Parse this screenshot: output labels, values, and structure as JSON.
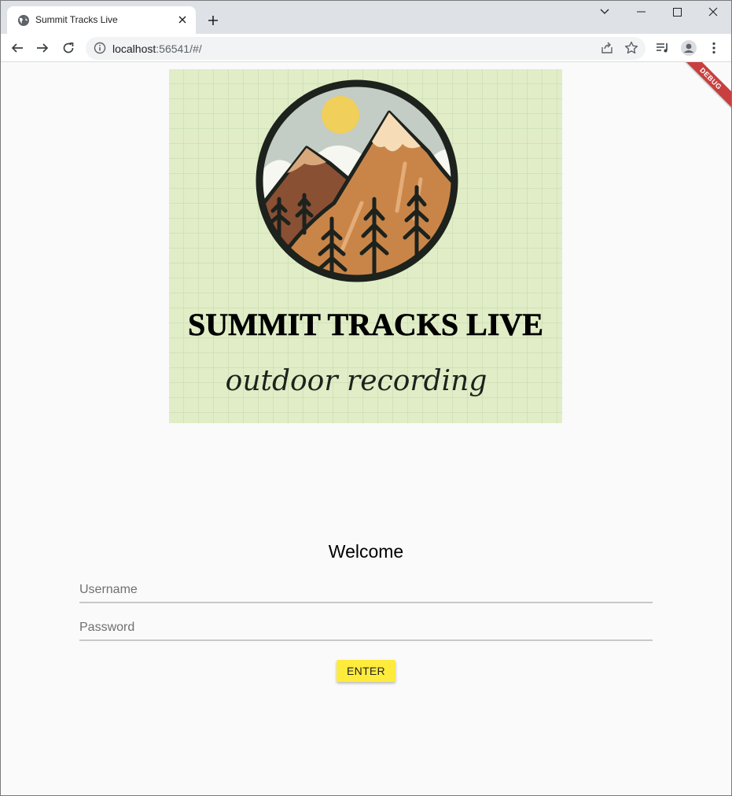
{
  "browser": {
    "tab_title": "Summit Tracks Live",
    "url_host": "localhost",
    "url_rest": ":56541/#/"
  },
  "banner": {
    "label": "DEBUG"
  },
  "logo": {
    "title": "SUMMIT TRACKS LIVE",
    "subtitle": "outdoor recording",
    "colors": {
      "background": "#e0edc6",
      "sky": "#c3ccc5",
      "sun": "#f0cf5a",
      "mountain": "#c98548",
      "dark_mountain": "#8a5034",
      "trees": "#222a22"
    }
  },
  "login": {
    "heading": "Welcome",
    "username_placeholder": "Username",
    "password_placeholder": "Password",
    "enter_label": "ENTER",
    "accent_color": "#ffeb3b"
  }
}
